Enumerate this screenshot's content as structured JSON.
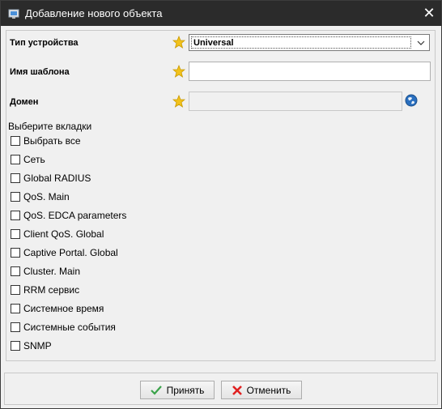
{
  "window": {
    "title": "Добавление нового объекта"
  },
  "form": {
    "device_type_label": "Тип устройства",
    "device_type_value": "Universal",
    "template_name_label": "Имя шаблона",
    "template_name_value": "",
    "domain_label": "Домен",
    "domain_value": ""
  },
  "tabs": {
    "section_label": "Выберите вкладки",
    "items": [
      {
        "label": "Выбрать все",
        "checked": false
      },
      {
        "label": "Сеть",
        "checked": false
      },
      {
        "label": "Global RADIUS",
        "checked": false
      },
      {
        "label": "QoS. Main",
        "checked": false
      },
      {
        "label": "QoS. EDCA parameters",
        "checked": false
      },
      {
        "label": "Client QoS. Global",
        "checked": false
      },
      {
        "label": "Captive Portal. Global",
        "checked": false
      },
      {
        "label": "Cluster. Main",
        "checked": false
      },
      {
        "label": "RRM сервис",
        "checked": false
      },
      {
        "label": "Системное время",
        "checked": false
      },
      {
        "label": "Системные события",
        "checked": false
      },
      {
        "label": "SNMP",
        "checked": false
      }
    ]
  },
  "buttons": {
    "accept": "Принять",
    "cancel": "Отменить"
  },
  "icons": {
    "required": "star-icon",
    "domain_picker": "globe-icon",
    "close": "close-icon"
  },
  "colors": {
    "titlebar": "#2b2b2b",
    "star": "#f2c21b",
    "accept_check": "#3aa34a",
    "cancel_x": "#e02020"
  }
}
